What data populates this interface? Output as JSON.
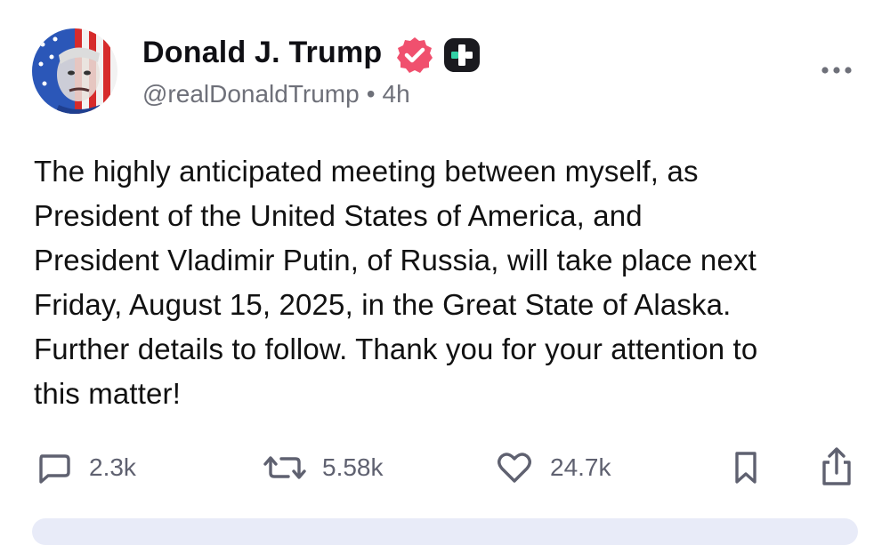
{
  "author": {
    "display_name": "Donald J. Trump",
    "handle": "@realDonaldTrump",
    "separator": "•",
    "timestamp": "4h",
    "verified": true,
    "verified_badge_color": "#f0506e",
    "plus_badge_color": "#1a1a1f",
    "plus_badge_accent": "#33d1a7"
  },
  "post": {
    "lines": [
      "The highly anticipated meeting between myself, as",
      "President of the United States of America, and",
      "President Vladimir Putin, of Russia, will take place next",
      "Friday, August 15, 2025, in the Great State of Alaska.",
      "Further details to follow. Thank you for your attention to",
      "this matter!"
    ]
  },
  "actions": {
    "replies": "2.3k",
    "reposts": "5.58k",
    "likes": "24.7k"
  },
  "icons": {
    "more": "more-horizontal-icon",
    "reply": "reply-bubble-icon",
    "repost": "repost-arrows-icon",
    "like": "heart-icon",
    "bookmark": "bookmark-icon",
    "share": "share-upload-icon"
  }
}
